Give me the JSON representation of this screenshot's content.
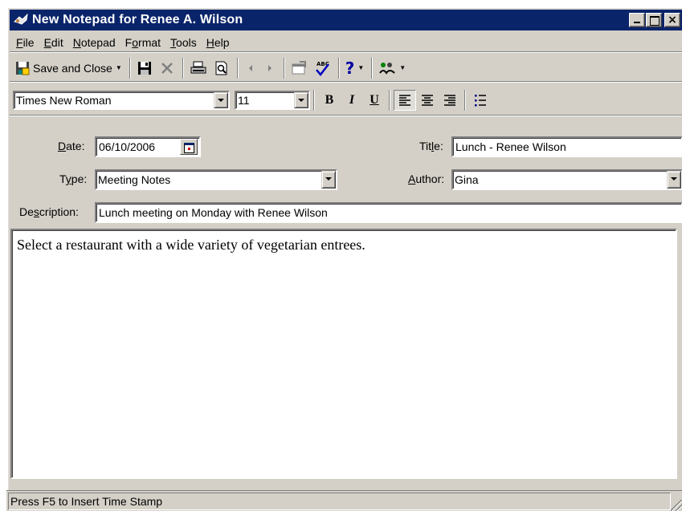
{
  "window": {
    "title": "New Notepad for Renee A. Wilson"
  },
  "menu": [
    {
      "pre": "",
      "key": "F",
      "post": "ile"
    },
    {
      "pre": "",
      "key": "E",
      "post": "dit"
    },
    {
      "pre": "",
      "key": "N",
      "post": "otepad"
    },
    {
      "pre": "F",
      "key": "o",
      "post": "rmat"
    },
    {
      "pre": "",
      "key": "T",
      "post": "ools"
    },
    {
      "pre": "",
      "key": "H",
      "post": "elp"
    }
  ],
  "toolbar": {
    "save_close_label": "Save and Close"
  },
  "format": {
    "font": "Times New Roman",
    "size": "11",
    "bold": "B",
    "italic": "I",
    "underline": "U"
  },
  "fields": {
    "date": {
      "label_pre": "",
      "label_key": "D",
      "label_post": "ate:",
      "value": "06/10/2006"
    },
    "title": {
      "label_pre": "Tit",
      "label_key": "l",
      "label_post": "e:",
      "value": "Lunch - Renee Wilson"
    },
    "type": {
      "label_pre": "T",
      "label_key": "y",
      "label_post": "pe:",
      "value": "Meeting Notes"
    },
    "author": {
      "label_pre": "",
      "label_key": "A",
      "label_post": "uthor:",
      "value": "Gina"
    },
    "description": {
      "label_pre": "De",
      "label_key": "s",
      "label_post": "cription:",
      "value": "Lunch meeting on Monday with Renee Wilson"
    }
  },
  "memo": {
    "text": "Select a restaurant with a wide variety of vegetarian entrees."
  },
  "status": {
    "text": "Press F5 to Insert Time Stamp"
  }
}
